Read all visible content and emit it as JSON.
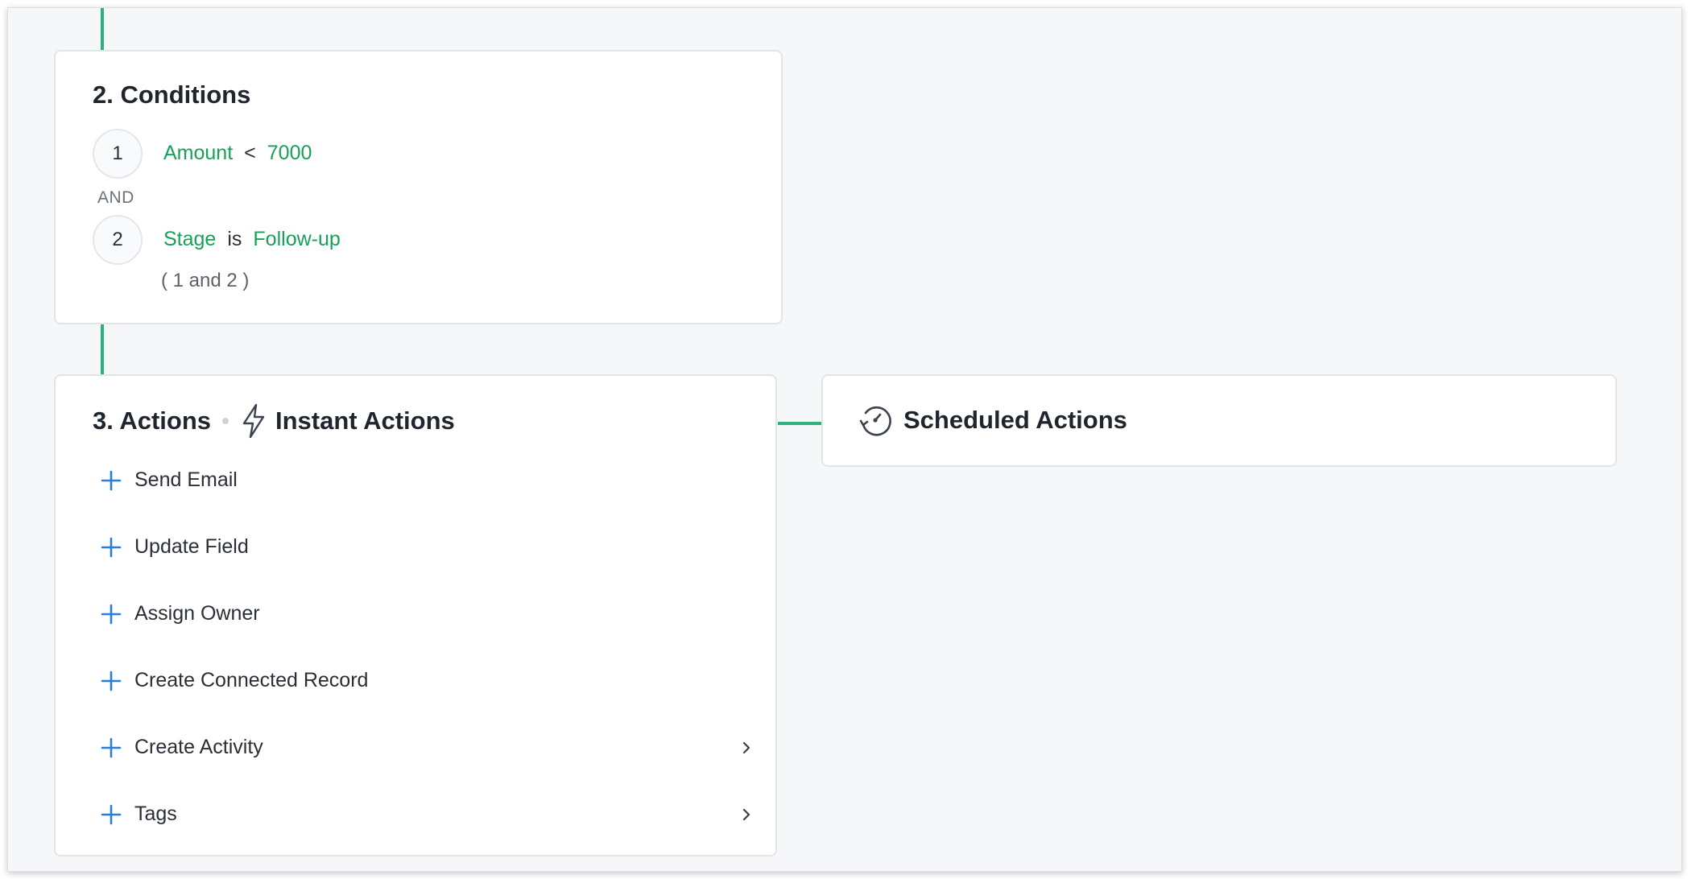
{
  "colors": {
    "accent_green": "#17a158",
    "connector_green": "#2db27c",
    "plus_blue": "#2a7fd4",
    "canvas_bg": "#f6f7f9"
  },
  "conditions": {
    "title": "2. Conditions",
    "rows": [
      {
        "number": "1",
        "field": "Amount",
        "operator": "<",
        "value": "7000"
      },
      {
        "number": "2",
        "field": "Stage",
        "operator": "is",
        "value": "Follow-up"
      }
    ],
    "joiner": "AND",
    "expression": "( 1 and 2 )"
  },
  "actions": {
    "title": "3. Actions",
    "instant_title": "Instant Actions",
    "instant_icon": "lightning-bolt-icon",
    "items": [
      {
        "label": "Send Email",
        "icon": "plus-icon"
      },
      {
        "label": "Update Field",
        "icon": "plus-icon"
      },
      {
        "label": "Assign Owner",
        "icon": "plus-icon"
      },
      {
        "label": "Create Connected Record",
        "icon": "plus-icon"
      },
      {
        "label": "Create Activity",
        "icon": "plus-icon",
        "submenu": "chevron-right-icon"
      },
      {
        "label": "Tags",
        "icon": "plus-icon",
        "submenu": "chevron-right-icon"
      }
    ]
  },
  "scheduled": {
    "title": "Scheduled Actions",
    "icon": "clock-refresh-icon"
  }
}
